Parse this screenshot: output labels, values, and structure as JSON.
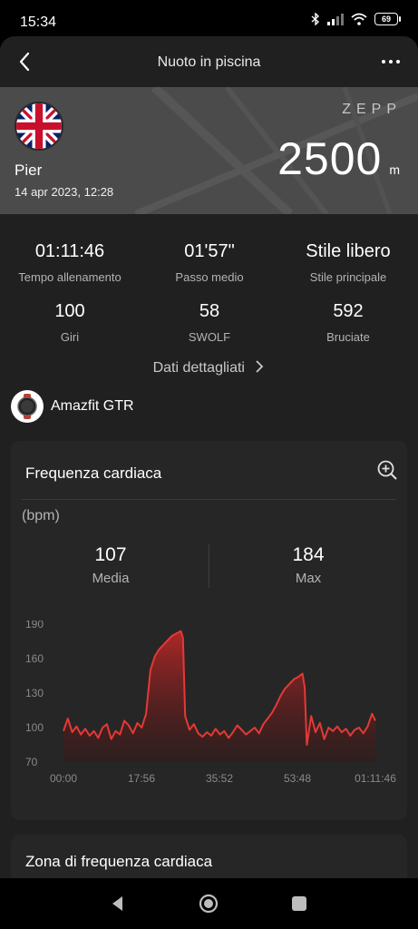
{
  "status_bar": {
    "time": "15:34",
    "battery": "69"
  },
  "header": {
    "title": "Nuoto in piscina"
  },
  "hero": {
    "brand": "ZEPP",
    "user_name": "Pier",
    "date": "14 apr 2023, 12:28",
    "distance_value": "2500",
    "distance_unit": "m"
  },
  "stats": [
    {
      "value": "01:11:46",
      "label": "Tempo allenamento"
    },
    {
      "value": "01'57\"",
      "label": "Passo medio"
    },
    {
      "value": "Stile libero",
      "label": "Stile principale"
    },
    {
      "value": "100",
      "label": "Giri"
    },
    {
      "value": "58",
      "label": "SWOLF"
    },
    {
      "value": "592",
      "label": "Bruciate"
    }
  ],
  "details_link": "Dati dettagliati",
  "device": {
    "name": "Amazfit GTR"
  },
  "heart_rate_card": {
    "title": "Frequenza cardiaca",
    "unit": "(bpm)",
    "average_value": "107",
    "average_label": "Media",
    "max_value": "184",
    "max_label": "Max"
  },
  "zone_card": {
    "title": "Zona di frequenza cardiaca"
  },
  "colors": {
    "line": "#e53935",
    "card_bg": "#262626",
    "app_bg": "#202020"
  },
  "chart_data": {
    "type": "area",
    "x_ticks": [
      "00:00",
      "17:56",
      "35:52",
      "53:48",
      "01:11:46"
    ],
    "y_ticks": [
      "190",
      "160",
      "130",
      "100",
      "70"
    ],
    "ylim": [
      70,
      190
    ],
    "xlim_minutes": [
      0,
      71.77
    ],
    "series": [
      {
        "x_minutes": [
          0,
          1,
          2,
          3,
          4,
          5,
          6,
          7,
          8,
          9,
          10,
          11,
          12,
          13,
          14,
          15,
          16,
          17,
          18,
          19,
          20,
          20.5,
          21,
          22,
          23,
          24,
          25,
          26,
          27,
          27.5,
          28,
          29,
          30,
          31,
          32,
          33,
          34,
          35,
          36,
          37,
          38,
          39,
          40,
          41,
          42,
          43,
          44,
          45,
          46,
          47,
          48,
          49,
          50,
          51,
          52,
          53,
          54,
          55,
          55.5,
          56,
          57,
          58,
          59,
          60,
          61,
          62,
          63,
          64,
          65,
          66,
          67,
          68,
          69,
          70,
          71,
          71.77
        ],
        "values": [
          97,
          108,
          96,
          101,
          94,
          99,
          93,
          97,
          91,
          100,
          103,
          90,
          97,
          94,
          106,
          102,
          95,
          104,
          100,
          112,
          150,
          156,
          162,
          168,
          172,
          176,
          180,
          182,
          184,
          178,
          110,
          98,
          103,
          95,
          92,
          96,
          93,
          99,
          94,
          97,
          91,
          96,
          102,
          98,
          94,
          97,
          100,
          95,
          103,
          108,
          113,
          120,
          128,
          134,
          138,
          142,
          144,
          147,
          135,
          85,
          110,
          96,
          104,
          90,
          100,
          97,
          101,
          96,
          99,
          93,
          98,
          100,
          95,
          101,
          112,
          106
        ]
      }
    ]
  }
}
